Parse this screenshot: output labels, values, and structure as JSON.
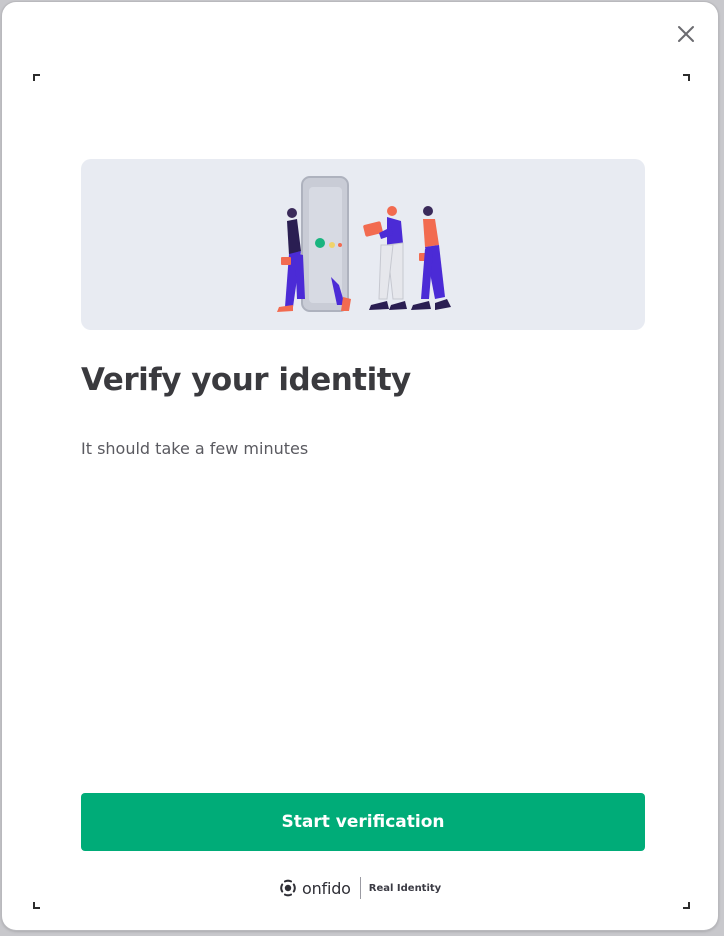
{
  "modal": {
    "close_icon": "close-icon",
    "title": "Verify your identity",
    "subtitle": "It should take a few minutes",
    "cta_label": "Start verification"
  },
  "illustration": {
    "icon": "people-with-phone-illustration"
  },
  "footer": {
    "brand_icon": "onfido-logo-icon",
    "brand_name": "onfido",
    "tagline": "Real Identity"
  },
  "colors": {
    "accent": "#00ac78",
    "illustration_bg": "#e8ebf2",
    "figure_purple": "#4b2bd6",
    "figure_orange": "#f26b50",
    "title_text": "#3a3a3e"
  }
}
